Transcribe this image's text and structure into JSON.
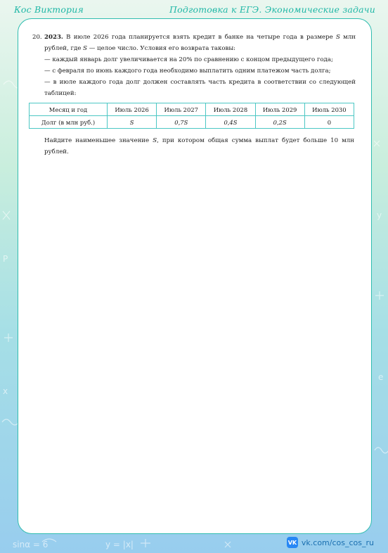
{
  "header": {
    "author": "Кос Виктория",
    "subject": "Подготовка к ЕГЭ. Экономические задачи"
  },
  "problem": {
    "number": "20.",
    "year": "2023.",
    "intro_1": " В июле 2026 года планируется взять кредит в банке на четыре года в размере ",
    "intro_var": "S",
    "intro_2": " млн рублей, где ",
    "intro_var_2": "S",
    "intro_3": " — целое число. Условия его возврата таковы:",
    "conditions": [
      "— каждый январь долг увеличивается на 20% по сравнению с концом предыдущего года;",
      "— с февраля по июнь каждого года необходимо выплатить одним платежом часть долга;",
      "— в июле каждого года долг должен составлять часть кредита в соответствии со следующей таблицей:"
    ],
    "table": {
      "header_row": [
        "Месяц и год",
        "Июль 2026",
        "Июль 2027",
        "Июль 2028",
        "Июль 2029",
        "Июль 2030"
      ],
      "debt_row": [
        "Долг (в млн руб.)",
        "S",
        "0,7S",
        "0,4S",
        "0,2S",
        "0"
      ]
    },
    "task_1": "Найдите наименьшее значение ",
    "task_var": "S",
    "task_2": ", при котором общая сумма выплат будет больше 10 млн рублей."
  },
  "footer": {
    "logo": "VK",
    "link": "vk.com/cos_cos_ru"
  },
  "colors": {
    "accent": "#1fb7a6",
    "border": "#31bdb0",
    "table_border": "#4cc7c4"
  }
}
